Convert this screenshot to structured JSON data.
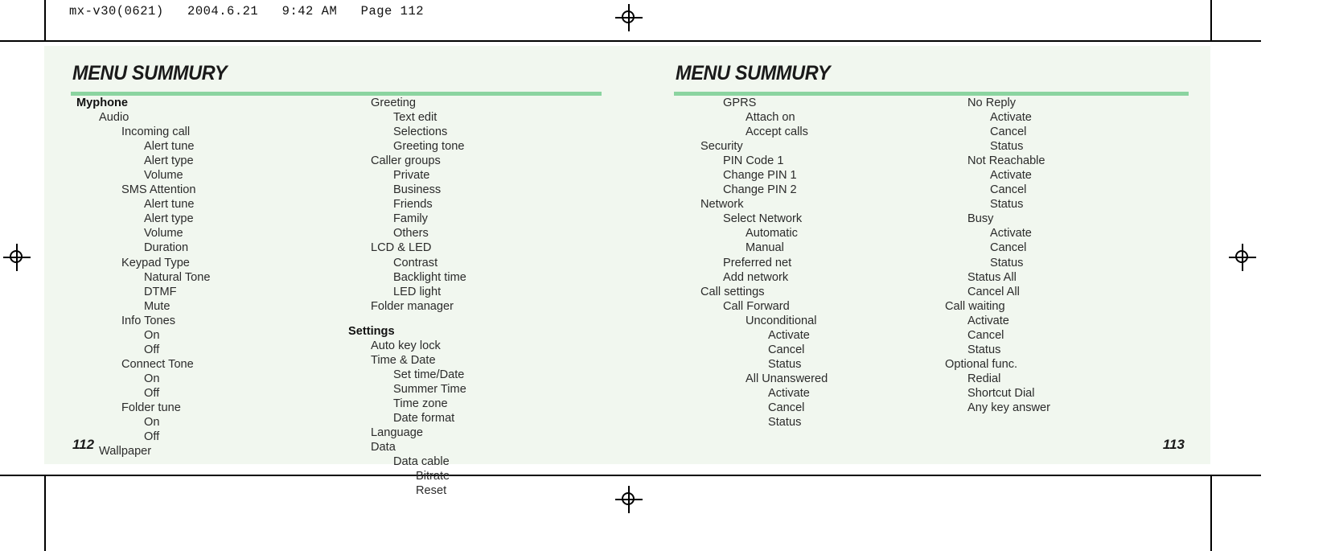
{
  "print_header": "mx-v30(0621)   2004.6.21   9:42 AM   Page 112",
  "theme": {
    "page_background": "#f1f7ef",
    "rule_color": "#8bd4a0",
    "text_color": "#2b2b2b",
    "paper_color": "#ffffff"
  },
  "left_page": {
    "title": "MENU SUMMURY",
    "folio": "112",
    "column_1": [
      {
        "label": "Myphone",
        "level": 0,
        "bold": true
      },
      {
        "label": "Audio",
        "level": 1,
        "bold": false
      },
      {
        "label": "Incoming call",
        "level": 2,
        "bold": false
      },
      {
        "label": "Alert tune",
        "level": 3,
        "bold": false
      },
      {
        "label": "Alert type",
        "level": 3,
        "bold": false
      },
      {
        "label": "Volume",
        "level": 3,
        "bold": false
      },
      {
        "label": "SMS Attention",
        "level": 2,
        "bold": false
      },
      {
        "label": "Alert tune",
        "level": 3,
        "bold": false
      },
      {
        "label": "Alert type",
        "level": 3,
        "bold": false
      },
      {
        "label": "Volume",
        "level": 3,
        "bold": false
      },
      {
        "label": "Duration",
        "level": 3,
        "bold": false
      },
      {
        "label": "Keypad Type",
        "level": 2,
        "bold": false
      },
      {
        "label": "Natural Tone",
        "level": 3,
        "bold": false
      },
      {
        "label": "DTMF",
        "level": 3,
        "bold": false
      },
      {
        "label": "Mute",
        "level": 3,
        "bold": false
      },
      {
        "label": "Info Tones",
        "level": 2,
        "bold": false
      },
      {
        "label": "On",
        "level": 3,
        "bold": false
      },
      {
        "label": "Off",
        "level": 3,
        "bold": false
      },
      {
        "label": "Connect Tone",
        "level": 2,
        "bold": false
      },
      {
        "label": "On",
        "level": 3,
        "bold": false
      },
      {
        "label": "Off",
        "level": 3,
        "bold": false
      },
      {
        "label": "Folder tune",
        "level": 2,
        "bold": false
      },
      {
        "label": "On",
        "level": 3,
        "bold": false
      },
      {
        "label": "Off",
        "level": 3,
        "bold": false
      },
      {
        "label": "Wallpaper",
        "level": 1,
        "bold": false
      }
    ],
    "column_2": [
      {
        "label": "Greeting",
        "level": 1,
        "bold": false
      },
      {
        "label": "Text edit",
        "level": 2,
        "bold": false
      },
      {
        "label": "Selections",
        "level": 2,
        "bold": false
      },
      {
        "label": "Greeting tone",
        "level": 2,
        "bold": false
      },
      {
        "label": "Caller groups",
        "level": 1,
        "bold": false
      },
      {
        "label": "Private",
        "level": 2,
        "bold": false
      },
      {
        "label": "Business",
        "level": 2,
        "bold": false
      },
      {
        "label": "Friends",
        "level": 2,
        "bold": false
      },
      {
        "label": "Family",
        "level": 2,
        "bold": false
      },
      {
        "label": "Others",
        "level": 2,
        "bold": false
      },
      {
        "label": "LCD & LED",
        "level": 1,
        "bold": false
      },
      {
        "label": "Contrast",
        "level": 2,
        "bold": false
      },
      {
        "label": "Backlight time",
        "level": 2,
        "bold": false
      },
      {
        "label": "LED light",
        "level": 2,
        "bold": false
      },
      {
        "label": "Folder manager",
        "level": 1,
        "bold": false
      },
      {
        "label": "Settings",
        "level": 0,
        "bold": true,
        "gap": true
      },
      {
        "label": "Auto key lock",
        "level": 1,
        "bold": false
      },
      {
        "label": "Time & Date",
        "level": 1,
        "bold": false
      },
      {
        "label": "Set time/Date",
        "level": 2,
        "bold": false
      },
      {
        "label": "Summer Time",
        "level": 2,
        "bold": false
      },
      {
        "label": "Time zone",
        "level": 2,
        "bold": false
      },
      {
        "label": "Date format",
        "level": 2,
        "bold": false
      },
      {
        "label": "Language",
        "level": 1,
        "bold": false
      },
      {
        "label": "Data",
        "level": 1,
        "bold": false
      },
      {
        "label": "Data cable",
        "level": 2,
        "bold": false
      },
      {
        "label": "Bitrate",
        "level": 3,
        "bold": false
      },
      {
        "label": "Reset",
        "level": 3,
        "bold": false
      }
    ]
  },
  "right_page": {
    "title": "MENU SUMMURY",
    "folio": "113",
    "column_1": [
      {
        "label": "GPRS",
        "level": 2,
        "bold": false
      },
      {
        "label": "Attach on",
        "level": 3,
        "bold": false
      },
      {
        "label": "Accept calls",
        "level": 3,
        "bold": false
      },
      {
        "label": "Security",
        "level": 1,
        "bold": false
      },
      {
        "label": "PIN Code 1",
        "level": 2,
        "bold": false
      },
      {
        "label": "Change PIN 1",
        "level": 2,
        "bold": false
      },
      {
        "label": "Change PIN 2",
        "level": 2,
        "bold": false
      },
      {
        "label": "Network",
        "level": 1,
        "bold": false
      },
      {
        "label": "Select Network",
        "level": 2,
        "bold": false
      },
      {
        "label": "Automatic",
        "level": 3,
        "bold": false
      },
      {
        "label": "Manual",
        "level": 3,
        "bold": false
      },
      {
        "label": "Preferred net",
        "level": 2,
        "bold": false
      },
      {
        "label": "Add network",
        "level": 2,
        "bold": false
      },
      {
        "label": "Call settings",
        "level": 1,
        "bold": false
      },
      {
        "label": "Call Forward",
        "level": 2,
        "bold": false
      },
      {
        "label": "Unconditional",
        "level": 3,
        "bold": false
      },
      {
        "label": "Activate",
        "level": 4,
        "bold": false
      },
      {
        "label": "Cancel",
        "level": 4,
        "bold": false
      },
      {
        "label": "Status",
        "level": 4,
        "bold": false
      },
      {
        "label": "All Unanswered",
        "level": 3,
        "bold": false
      },
      {
        "label": "Activate",
        "level": 4,
        "bold": false
      },
      {
        "label": "Cancel",
        "level": 4,
        "bold": false
      },
      {
        "label": "Status",
        "level": 4,
        "bold": false
      }
    ],
    "column_2": [
      {
        "label": "No Reply",
        "level": 1,
        "bold": false
      },
      {
        "label": "Activate",
        "level": 2,
        "bold": false
      },
      {
        "label": "Cancel",
        "level": 2,
        "bold": false
      },
      {
        "label": "Status",
        "level": 2,
        "bold": false
      },
      {
        "label": "Not Reachable",
        "level": 1,
        "bold": false
      },
      {
        "label": "Activate",
        "level": 2,
        "bold": false
      },
      {
        "label": "Cancel",
        "level": 2,
        "bold": false
      },
      {
        "label": "Status",
        "level": 2,
        "bold": false
      },
      {
        "label": "Busy",
        "level": 1,
        "bold": false
      },
      {
        "label": "Activate",
        "level": 2,
        "bold": false
      },
      {
        "label": "Cancel",
        "level": 2,
        "bold": false
      },
      {
        "label": "Status",
        "level": 2,
        "bold": false
      },
      {
        "label": "Status All",
        "level": 1,
        "bold": false
      },
      {
        "label": "Cancel All",
        "level": 1,
        "bold": false
      },
      {
        "label": "Call waiting",
        "level": 0,
        "bold": false
      },
      {
        "label": "Activate",
        "level": 1,
        "bold": false
      },
      {
        "label": "Cancel",
        "level": 1,
        "bold": false
      },
      {
        "label": "Status",
        "level": 1,
        "bold": false
      },
      {
        "label": "Optional func.",
        "level": 0,
        "bold": false
      },
      {
        "label": "Redial",
        "level": 1,
        "bold": false
      },
      {
        "label": "Shortcut Dial",
        "level": 1,
        "bold": false
      },
      {
        "label": "Any key answer",
        "level": 1,
        "bold": false
      }
    ]
  }
}
